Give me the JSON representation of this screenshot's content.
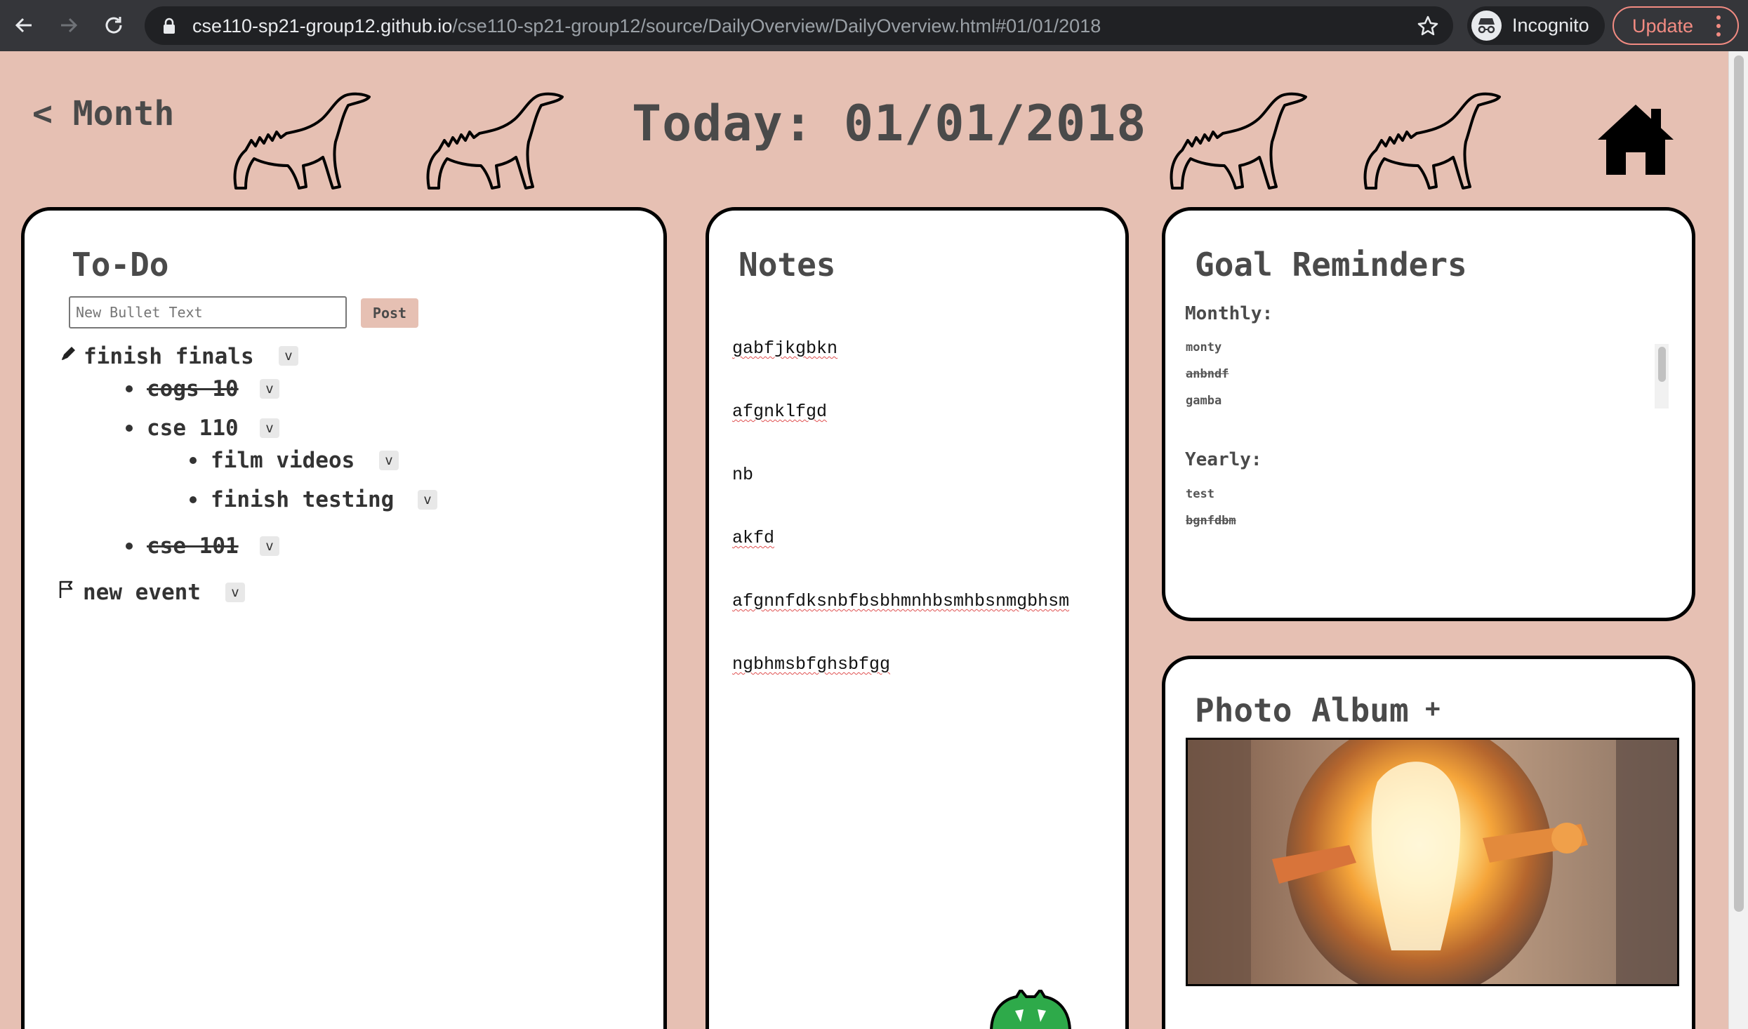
{
  "browser": {
    "url_host": "cse110-sp21-group12.github.io",
    "url_path": "/cse110-sp21-group12/source/DailyOverview/DailyOverview.html#01/01/2018",
    "profile_label": "Incognito",
    "update_label": "Update"
  },
  "header": {
    "month_link": "< Month",
    "today": "Today: 01/01/2018"
  },
  "todo": {
    "title": "To-Do",
    "input_placeholder": "New Bullet Text",
    "post_label": "Post",
    "toggle_label": "v",
    "items": [
      {
        "text": "finish finals",
        "icon": "pencil-icon",
        "done": false
      },
      {
        "text": "cogs 10",
        "done": true
      },
      {
        "text": "cse 110",
        "done": false
      },
      {
        "text": "film videos",
        "done": false
      },
      {
        "text": "finish testing",
        "done": false
      },
      {
        "text": "cse 101",
        "done": true
      },
      {
        "text": "new event",
        "icon": "flag-icon",
        "done": false
      }
    ]
  },
  "notes": {
    "title": "Notes",
    "lines": [
      "gabfjkgbkn",
      "afgnklfgd",
      "nb",
      "akfd",
      "afgnnfdksnbfbsbhmnhbsmhbsnmgbhsm",
      "ngbhmsbfghsbfgg"
    ]
  },
  "goals": {
    "title": "Goal Reminders",
    "monthly_label": "Monthly:",
    "monthly": [
      {
        "text": "monty",
        "done": false
      },
      {
        "text": "anbndf",
        "done": true
      },
      {
        "text": "gamba",
        "done": false
      }
    ],
    "yearly_label": "Yearly:",
    "yearly": [
      {
        "text": "test",
        "done": false
      },
      {
        "text": "bgnfdbm",
        "done": true
      }
    ]
  },
  "album": {
    "title": "Photo Album",
    "add_label": "+"
  },
  "colors": {
    "page_background": "#e6c0b3",
    "panel_background": "#ffffff",
    "heading": "#4a4a4a"
  }
}
